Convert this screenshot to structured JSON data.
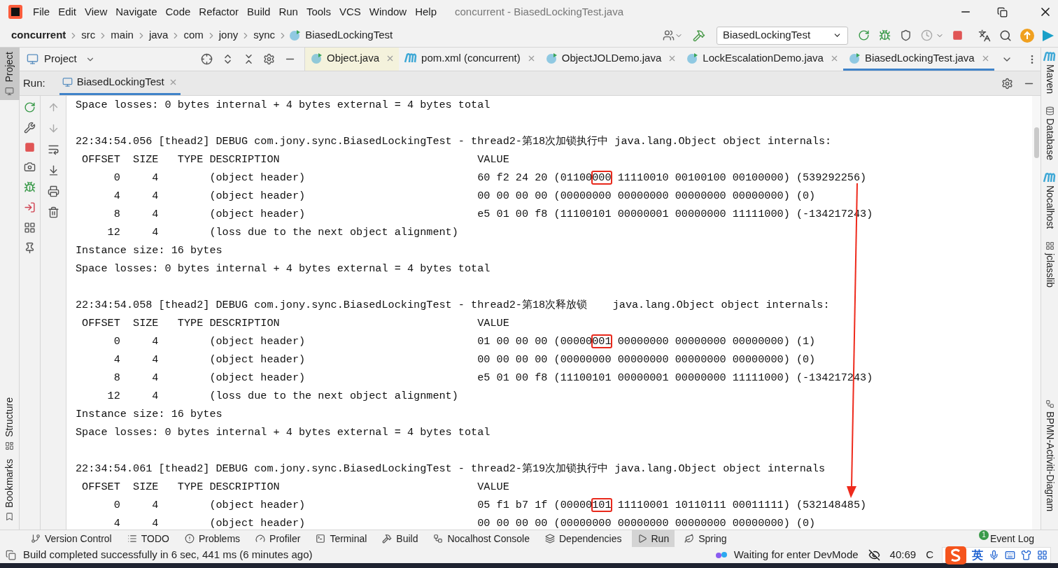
{
  "menu": [
    "File",
    "Edit",
    "View",
    "Navigate",
    "Code",
    "Refactor",
    "Build",
    "Run",
    "Tools",
    "VCS",
    "Window",
    "Help"
  ],
  "window_title": "concurrent - BiasedLockingTest.java",
  "breadcrumbs": [
    {
      "label": "concurrent",
      "kind": "project"
    },
    {
      "label": "src",
      "kind": "folder"
    },
    {
      "label": "main",
      "kind": "folder"
    },
    {
      "label": "java",
      "kind": "folder"
    },
    {
      "label": "com",
      "kind": "folder"
    },
    {
      "label": "jony",
      "kind": "folder"
    },
    {
      "label": "sync",
      "kind": "folder"
    },
    {
      "label": "BiasedLockingTest",
      "kind": "class"
    }
  ],
  "run_config": "BiasedLockingTest",
  "project_panel": {
    "title": "Project"
  },
  "editor_tabs": [
    {
      "label": "Object.java",
      "kind": "class",
      "selected": false,
      "readonly": true
    },
    {
      "label": "pom.xml (concurrent)",
      "kind": "maven",
      "selected": false,
      "readonly": false
    },
    {
      "label": "ObjectJOLDemo.java",
      "kind": "class",
      "selected": false,
      "readonly": false
    },
    {
      "label": "LockEscalationDemo.java",
      "kind": "class",
      "selected": false,
      "readonly": false
    },
    {
      "label": "BiasedLockingTest.java",
      "kind": "class",
      "selected": true,
      "readonly": false
    }
  ],
  "run_panel": {
    "label": "Run:",
    "tab": "BiasedLockingTest"
  },
  "left_stripe": [
    {
      "label": "Project",
      "selected": true
    },
    {
      "label": "Structure",
      "selected": false
    },
    {
      "label": "Bookmarks",
      "selected": false
    }
  ],
  "right_stripe": [
    "Maven",
    "Database",
    "Nocalhost",
    "jclasslib",
    "BPMN-Activiti-Diagram"
  ],
  "console": {
    "lines": [
      {
        "kind": "text",
        "parts": [
          {
            "text": "Space losses: 0 bytes internal + 4 bytes external = 4 bytes total",
            "marked": false
          }
        ]
      },
      {
        "kind": "blank"
      },
      {
        "kind": "text",
        "parts": [
          {
            "text": "22:34:54.056 [thead2] DEBUG com.jony.sync.BiasedLockingTest - thread2-第18次加锁执行中 java.lang.Object object internals:",
            "marked": false
          }
        ]
      },
      {
        "kind": "text",
        "parts": [
          {
            "text": " OFFSET  SIZE   TYPE DESCRIPTION                               VALUE",
            "marked": false
          }
        ]
      },
      {
        "kind": "text",
        "parts": [
          {
            "text": "      0     4        (object header)                           60 f2 24 20 (01100",
            "marked": false
          },
          {
            "text": "000",
            "marked": true
          },
          {
            "text": " 11110010 00100100 00100000) (539292256)",
            "marked": false
          }
        ]
      },
      {
        "kind": "text",
        "parts": [
          {
            "text": "      4     4        (object header)                           00 00 00 00 (00000000 00000000 00000000 00000000) (0)",
            "marked": false
          }
        ]
      },
      {
        "kind": "text",
        "parts": [
          {
            "text": "      8     4        (object header)                           e5 01 00 f8 (11100101 00000001 00000000 11111000) (-134217243)",
            "marked": false
          }
        ]
      },
      {
        "kind": "text",
        "parts": [
          {
            "text": "     12     4        (loss due to the next object alignment)",
            "marked": false
          }
        ]
      },
      {
        "kind": "text",
        "parts": [
          {
            "text": "Instance size: 16 bytes",
            "marked": false
          }
        ]
      },
      {
        "kind": "text",
        "parts": [
          {
            "text": "Space losses: 0 bytes internal + 4 bytes external = 4 bytes total",
            "marked": false
          }
        ]
      },
      {
        "kind": "blank"
      },
      {
        "kind": "text",
        "parts": [
          {
            "text": "22:34:54.058 [thead2] DEBUG com.jony.sync.BiasedLockingTest - thread2-第18次释放锁    java.lang.Object object internals:",
            "marked": false
          }
        ]
      },
      {
        "kind": "text",
        "parts": [
          {
            "text": " OFFSET  SIZE   TYPE DESCRIPTION                               VALUE",
            "marked": false
          }
        ]
      },
      {
        "kind": "text",
        "parts": [
          {
            "text": "      0     4        (object header)                           01 00 00 00 (00000",
            "marked": false
          },
          {
            "text": "001",
            "marked": true
          },
          {
            "text": " 00000000 00000000 00000000) (1)",
            "marked": false
          }
        ]
      },
      {
        "kind": "text",
        "parts": [
          {
            "text": "      4     4        (object header)                           00 00 00 00 (00000000 00000000 00000000 00000000) (0)",
            "marked": false
          }
        ]
      },
      {
        "kind": "text",
        "parts": [
          {
            "text": "      8     4        (object header)                           e5 01 00 f8 (11100101 00000001 00000000 11111000) (-134217243)",
            "marked": false
          }
        ]
      },
      {
        "kind": "text",
        "parts": [
          {
            "text": "     12     4        (loss due to the next object alignment)",
            "marked": false
          }
        ]
      },
      {
        "kind": "text",
        "parts": [
          {
            "text": "Instance size: 16 bytes",
            "marked": false
          }
        ]
      },
      {
        "kind": "text",
        "parts": [
          {
            "text": "Space losses: 0 bytes internal + 4 bytes external = 4 bytes total",
            "marked": false
          }
        ]
      },
      {
        "kind": "blank"
      },
      {
        "kind": "text",
        "parts": [
          {
            "text": "22:34:54.061 [thead2] DEBUG com.jony.sync.BiasedLockingTest - thread2-第19次加锁执行中 java.lang.Object object internals",
            "marked": false
          }
        ]
      },
      {
        "kind": "text",
        "parts": [
          {
            "text": " OFFSET  SIZE   TYPE DESCRIPTION                               VALUE",
            "marked": false
          }
        ]
      },
      {
        "kind": "text",
        "parts": [
          {
            "text": "      0     4        (object header)                           05 f1 b7 1f (00000",
            "marked": false
          },
          {
            "text": "101",
            "marked": true
          },
          {
            "text": " 11110001 10110111 00011111) (532148485)",
            "marked": false
          }
        ]
      },
      {
        "kind": "text",
        "parts": [
          {
            "text": "      4     4        (object header)                           00 00 00 00 (00000000 00000000 00000000 00000000) (0)",
            "marked": false
          }
        ]
      }
    ]
  },
  "tool_windows": [
    {
      "label": "Version Control",
      "kind": "vcs",
      "selected": false
    },
    {
      "label": "TODO",
      "kind": "todo",
      "selected": false
    },
    {
      "label": "Problems",
      "kind": "problems",
      "selected": false
    },
    {
      "label": "Profiler",
      "kind": "profiler",
      "selected": false
    },
    {
      "label": "Terminal",
      "kind": "terminal",
      "selected": false
    },
    {
      "label": "Build",
      "kind": "build",
      "selected": false
    },
    {
      "label": "Nocalhost Console",
      "kind": "nocalhost",
      "selected": false
    },
    {
      "label": "Dependencies",
      "kind": "deps",
      "selected": false
    },
    {
      "label": "Run",
      "kind": "run",
      "selected": true
    },
    {
      "label": "Spring",
      "kind": "spring",
      "selected": false
    }
  ],
  "event_log": {
    "label": "Event Log",
    "badge": "1"
  },
  "status": {
    "message": "Build completed successfully in 6 sec, 441 ms (6 minutes ago)",
    "devmode": "Waiting for enter DevMode",
    "position": "40:69",
    "extra": "C"
  },
  "ime": {
    "label": "英"
  }
}
